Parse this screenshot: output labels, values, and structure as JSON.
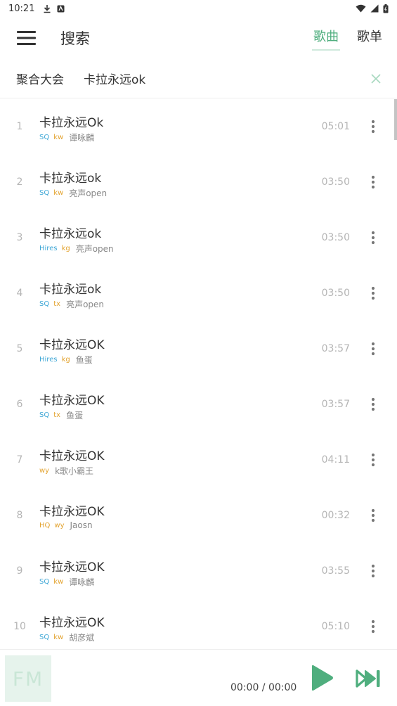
{
  "status_bar": {
    "time": "10:21"
  },
  "header": {
    "title": "搜索",
    "tabs": [
      {
        "label": "歌曲",
        "active": true
      },
      {
        "label": "歌单",
        "active": false
      }
    ]
  },
  "search": {
    "source": "聚合大会",
    "query": "卡拉永远ok"
  },
  "colors": {
    "accent": "#4fae7e",
    "quality_blue": "#3fa7d6",
    "source_orange": "#e3a32f"
  },
  "songs": [
    {
      "index": "1",
      "name": "卡拉永远Ok",
      "quality": "SQ",
      "source": "kw",
      "singer": "谭咏麟",
      "duration": "05:01"
    },
    {
      "index": "2",
      "name": "卡拉永远ok",
      "quality": "SQ",
      "source": "kw",
      "singer": "亮声open",
      "duration": "03:50"
    },
    {
      "index": "3",
      "name": "卡拉永远ok",
      "quality": "Hires",
      "source": "kg",
      "singer": "亮声open",
      "duration": "03:50"
    },
    {
      "index": "4",
      "name": "卡拉永远ok",
      "quality": "SQ",
      "source": "tx",
      "singer": "亮声open",
      "duration": "03:50"
    },
    {
      "index": "5",
      "name": "卡拉永远OK",
      "quality": "Hires",
      "source": "kg",
      "singer": "鱼蛋",
      "duration": "03:57"
    },
    {
      "index": "6",
      "name": "卡拉永远OK",
      "quality": "SQ",
      "source": "tx",
      "singer": "鱼蛋",
      "duration": "03:57"
    },
    {
      "index": "7",
      "name": "卡拉永远OK",
      "quality": "",
      "source": "wy",
      "singer": "k歌小霸王",
      "duration": "04:11"
    },
    {
      "index": "8",
      "name": "卡拉永远OK",
      "quality": "HQ",
      "source": "wy",
      "singer": "Jaosn",
      "duration": "00:32"
    },
    {
      "index": "9",
      "name": "卡拉永远OK",
      "quality": "SQ",
      "source": "kw",
      "singer": "谭咏麟",
      "duration": "03:55"
    },
    {
      "index": "10",
      "name": "卡拉永远OK",
      "quality": "SQ",
      "source": "kw",
      "singer": "胡彦斌",
      "duration": "05:10"
    }
  ],
  "player": {
    "cover_text": "FM",
    "time": "00:00 / 00:00"
  }
}
